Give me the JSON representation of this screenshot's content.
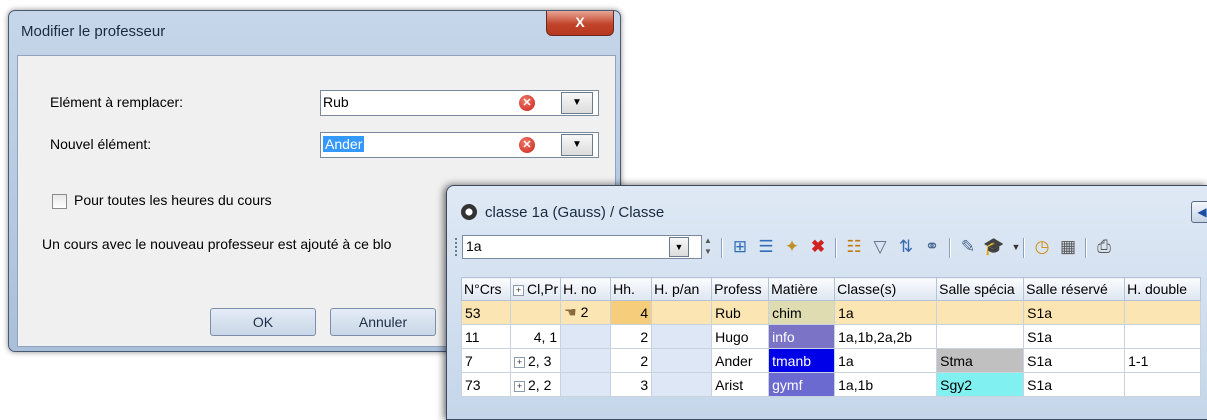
{
  "dialog": {
    "title": "Modifier le professeur",
    "close_label": "X",
    "replace_label": "Elément à remplacer:",
    "replace_value": "Rub",
    "new_label": "Nouvel élément:",
    "new_value": "Ander",
    "checkbox_label": "Pour toutes les heures du cours",
    "checkbox_checked": false,
    "info_text": "Un cours avec le nouveau professeur est ajouté à ce blo",
    "ok_label": "OK",
    "cancel_label": "Annuler"
  },
  "window": {
    "title": "classe 1a (Gauss) / Classe",
    "selector_value": "1a"
  },
  "grid": {
    "columns": [
      "N°Crs",
      "Cl,Pr",
      "H. no",
      "Hh.",
      "H. p/an",
      "Profess",
      "Matière",
      "Classe(s)",
      "Salle spécia",
      "Salle réservé",
      "H. double"
    ],
    "rows": [
      {
        "ncrs": "53",
        "clpr": "",
        "hno": "2",
        "hh": "4",
        "hpan": "",
        "prof": "Rub",
        "matiere": "chim",
        "classes": "1a",
        "salle_spec": "",
        "salle_res": "S1a",
        "hdouble": "",
        "selected": true
      },
      {
        "ncrs": "11",
        "clpr": "4, 1",
        "hno": "",
        "hh": "2",
        "hpan": "",
        "prof": "Hugo",
        "matiere": "info",
        "classes": "1a,1b,2a,2b",
        "salle_spec": "",
        "salle_res": "S1a",
        "hdouble": ""
      },
      {
        "ncrs": "7",
        "clpr": "2, 3",
        "hno": "",
        "hh": "2",
        "hpan": "",
        "prof": "Ander",
        "matiere": "tmanb",
        "classes": "1a",
        "salle_spec": "Stma",
        "salle_res": "S1a",
        "hdouble": "1-1"
      },
      {
        "ncrs": "73",
        "clpr": "2, 2",
        "hno": "",
        "hh": "3",
        "hpan": "",
        "prof": "Arist",
        "matiere": "gymf",
        "classes": "1a,1b",
        "salle_spec": "Sgy2",
        "salle_res": "S1a",
        "hdouble": ""
      }
    ]
  },
  "colors": {
    "matiere_chim": "#dedcb0",
    "matiere_info": "#7b73c6",
    "matiere_tmanb": "#0000e8",
    "matiere_gymf": "#6a6ad0",
    "salle_stma": "#c0c0c0",
    "salle_sgy2": "#80f0f0"
  }
}
